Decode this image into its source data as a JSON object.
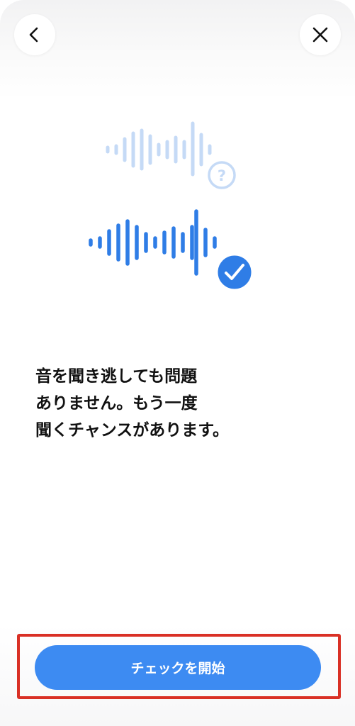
{
  "header": {
    "back_icon": "chevron-left-icon",
    "close_icon": "close-icon"
  },
  "illustration": {
    "faded_wave_icon": "audio-waveform-icon",
    "question_badge": "?",
    "active_wave_icon": "audio-waveform-icon",
    "check_badge_icon": "checkmark-icon",
    "faded_color": "#c5daf6",
    "active_color": "#2f7de6"
  },
  "message": {
    "line1": "音を聞き逃しても問題",
    "line2": "ありません。もう一度",
    "line3": "聞くチャンスがあります。"
  },
  "cta": {
    "label": "チェックを開始",
    "color": "#3d8bf2",
    "highlight_color": "#d93025"
  }
}
